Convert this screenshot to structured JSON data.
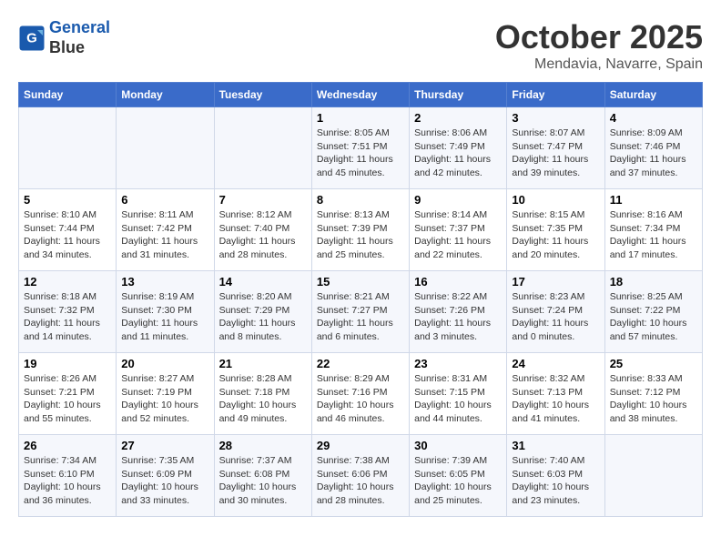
{
  "header": {
    "logo_line1": "General",
    "logo_line2": "Blue",
    "month": "October 2025",
    "location": "Mendavia, Navarre, Spain"
  },
  "days_of_week": [
    "Sunday",
    "Monday",
    "Tuesday",
    "Wednesday",
    "Thursday",
    "Friday",
    "Saturday"
  ],
  "weeks": [
    [
      {
        "day": "",
        "info": ""
      },
      {
        "day": "",
        "info": ""
      },
      {
        "day": "",
        "info": ""
      },
      {
        "day": "1",
        "info": "Sunrise: 8:05 AM\nSunset: 7:51 PM\nDaylight: 11 hours\nand 45 minutes."
      },
      {
        "day": "2",
        "info": "Sunrise: 8:06 AM\nSunset: 7:49 PM\nDaylight: 11 hours\nand 42 minutes."
      },
      {
        "day": "3",
        "info": "Sunrise: 8:07 AM\nSunset: 7:47 PM\nDaylight: 11 hours\nand 39 minutes."
      },
      {
        "day": "4",
        "info": "Sunrise: 8:09 AM\nSunset: 7:46 PM\nDaylight: 11 hours\nand 37 minutes."
      }
    ],
    [
      {
        "day": "5",
        "info": "Sunrise: 8:10 AM\nSunset: 7:44 PM\nDaylight: 11 hours\nand 34 minutes."
      },
      {
        "day": "6",
        "info": "Sunrise: 8:11 AM\nSunset: 7:42 PM\nDaylight: 11 hours\nand 31 minutes."
      },
      {
        "day": "7",
        "info": "Sunrise: 8:12 AM\nSunset: 7:40 PM\nDaylight: 11 hours\nand 28 minutes."
      },
      {
        "day": "8",
        "info": "Sunrise: 8:13 AM\nSunset: 7:39 PM\nDaylight: 11 hours\nand 25 minutes."
      },
      {
        "day": "9",
        "info": "Sunrise: 8:14 AM\nSunset: 7:37 PM\nDaylight: 11 hours\nand 22 minutes."
      },
      {
        "day": "10",
        "info": "Sunrise: 8:15 AM\nSunset: 7:35 PM\nDaylight: 11 hours\nand 20 minutes."
      },
      {
        "day": "11",
        "info": "Sunrise: 8:16 AM\nSunset: 7:34 PM\nDaylight: 11 hours\nand 17 minutes."
      }
    ],
    [
      {
        "day": "12",
        "info": "Sunrise: 8:18 AM\nSunset: 7:32 PM\nDaylight: 11 hours\nand 14 minutes."
      },
      {
        "day": "13",
        "info": "Sunrise: 8:19 AM\nSunset: 7:30 PM\nDaylight: 11 hours\nand 11 minutes."
      },
      {
        "day": "14",
        "info": "Sunrise: 8:20 AM\nSunset: 7:29 PM\nDaylight: 11 hours\nand 8 minutes."
      },
      {
        "day": "15",
        "info": "Sunrise: 8:21 AM\nSunset: 7:27 PM\nDaylight: 11 hours\nand 6 minutes."
      },
      {
        "day": "16",
        "info": "Sunrise: 8:22 AM\nSunset: 7:26 PM\nDaylight: 11 hours\nand 3 minutes."
      },
      {
        "day": "17",
        "info": "Sunrise: 8:23 AM\nSunset: 7:24 PM\nDaylight: 11 hours\nand 0 minutes."
      },
      {
        "day": "18",
        "info": "Sunrise: 8:25 AM\nSunset: 7:22 PM\nDaylight: 10 hours\nand 57 minutes."
      }
    ],
    [
      {
        "day": "19",
        "info": "Sunrise: 8:26 AM\nSunset: 7:21 PM\nDaylight: 10 hours\nand 55 minutes."
      },
      {
        "day": "20",
        "info": "Sunrise: 8:27 AM\nSunset: 7:19 PM\nDaylight: 10 hours\nand 52 minutes."
      },
      {
        "day": "21",
        "info": "Sunrise: 8:28 AM\nSunset: 7:18 PM\nDaylight: 10 hours\nand 49 minutes."
      },
      {
        "day": "22",
        "info": "Sunrise: 8:29 AM\nSunset: 7:16 PM\nDaylight: 10 hours\nand 46 minutes."
      },
      {
        "day": "23",
        "info": "Sunrise: 8:31 AM\nSunset: 7:15 PM\nDaylight: 10 hours\nand 44 minutes."
      },
      {
        "day": "24",
        "info": "Sunrise: 8:32 AM\nSunset: 7:13 PM\nDaylight: 10 hours\nand 41 minutes."
      },
      {
        "day": "25",
        "info": "Sunrise: 8:33 AM\nSunset: 7:12 PM\nDaylight: 10 hours\nand 38 minutes."
      }
    ],
    [
      {
        "day": "26",
        "info": "Sunrise: 7:34 AM\nSunset: 6:10 PM\nDaylight: 10 hours\nand 36 minutes."
      },
      {
        "day": "27",
        "info": "Sunrise: 7:35 AM\nSunset: 6:09 PM\nDaylight: 10 hours\nand 33 minutes."
      },
      {
        "day": "28",
        "info": "Sunrise: 7:37 AM\nSunset: 6:08 PM\nDaylight: 10 hours\nand 30 minutes."
      },
      {
        "day": "29",
        "info": "Sunrise: 7:38 AM\nSunset: 6:06 PM\nDaylight: 10 hours\nand 28 minutes."
      },
      {
        "day": "30",
        "info": "Sunrise: 7:39 AM\nSunset: 6:05 PM\nDaylight: 10 hours\nand 25 minutes."
      },
      {
        "day": "31",
        "info": "Sunrise: 7:40 AM\nSunset: 6:03 PM\nDaylight: 10 hours\nand 23 minutes."
      },
      {
        "day": "",
        "info": ""
      }
    ]
  ]
}
